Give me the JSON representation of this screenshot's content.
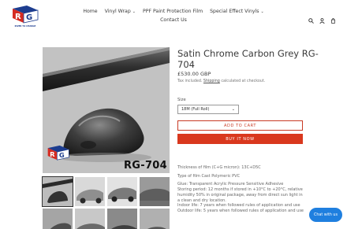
{
  "brand": {
    "logo_letters": "RG",
    "tagline": "RIVER TO CHANGE",
    "colors": {
      "red": "#d62c22",
      "blue": "#1d3d8f"
    }
  },
  "nav": {
    "items": [
      {
        "label": "Home"
      },
      {
        "label": "Vinyl Wrap",
        "has_dropdown": true
      },
      {
        "label": "PPF Paint Protection Film"
      },
      {
        "label": "Special Effect Vinyls",
        "has_dropdown": true
      }
    ],
    "second_row": [
      {
        "label": "Contact Us"
      }
    ],
    "dropdown_caret": "⌄"
  },
  "header_icons": [
    "search-icon",
    "user-icon",
    "cart-icon"
  ],
  "product": {
    "title": "Satin Chrome Carbon Grey RG-704",
    "price": "£530.00 GBP",
    "tax_prefix": "Tax included.",
    "tax_link": "Shipping",
    "tax_suffix": "calculated at checkout.",
    "image_label": "RG-704",
    "size_label": "Size",
    "size_value": "18M (Full Roll)",
    "add_to_cart": "ADD TO CART",
    "buy_now": "BUY IT NOW",
    "description": [
      "Thickness of film (C+G micron): 13C+D5C",
      "Type of film Cast Polymeric PVC",
      "Glue: Transparent Acrylic Pressure Sensitive Adhesive",
      "Storing period: 12 months if stored in +10°C to +20°C, relative",
      "humidity 50% in original package, away from direct sun light in",
      "a clean and dry location.",
      "Indoor life: 7 years when followed rules of application and use",
      "Outdoor life: 5 years when followed rules of application and use"
    ]
  },
  "thumbnails": [
    {
      "name": "thumb-1",
      "active": true
    },
    {
      "name": "thumb-2"
    },
    {
      "name": "thumb-3"
    },
    {
      "name": "thumb-4"
    },
    {
      "name": "thumb-5"
    },
    {
      "name": "thumb-6"
    },
    {
      "name": "thumb-7"
    },
    {
      "name": "thumb-8"
    }
  ],
  "chat": {
    "label": "Chat with us"
  },
  "colors": {
    "accent": "#d9381e",
    "chat": "#1f7fdf"
  }
}
